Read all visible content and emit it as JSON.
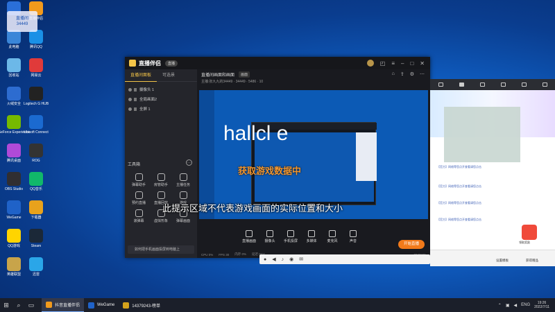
{
  "desktop": {
    "icons": [
      {
        "label": "",
        "color": "#2a6fd8"
      },
      {
        "label": "直播伴侣",
        "color": "#f29a1c"
      },
      {
        "label": "此电脑",
        "color": "#3a86d8"
      },
      {
        "label": "腾讯QQ",
        "color": "#1a90e6"
      },
      {
        "label": "回收站",
        "color": "#6cb8e8"
      },
      {
        "label": "网易云",
        "color": "#e03a3a"
      },
      {
        "label": "火绒安全",
        "color": "#2d6cd0"
      },
      {
        "label": "Logitech G HUB",
        "color": "#222222"
      },
      {
        "label": "GeForce Experience",
        "color": "#76b900"
      },
      {
        "label": "Ubisoft Connect",
        "color": "#1b6ad0"
      },
      {
        "label": "腾讯桌面",
        "color": "#b04ad8"
      },
      {
        "label": "ROG",
        "color": "#333333"
      },
      {
        "label": "OBS Studio",
        "color": "#302e31"
      },
      {
        "label": "QQ音乐",
        "color": "#11b86a"
      },
      {
        "label": "WeGame",
        "color": "#1f62c8"
      },
      {
        "label": "下载器",
        "color": "#e8a21c"
      },
      {
        "label": "QQ游戏",
        "color": "#ffd400"
      },
      {
        "label": "Steam",
        "color": "#1b2838"
      },
      {
        "label": "英雄联盟",
        "color": "#c8a44a"
      },
      {
        "label": "迅雷",
        "color": "#2aa6e8"
      }
    ],
    "overlay_badge": "直播间",
    "overlay_number": "34449"
  },
  "app": {
    "logo_text": "直播伴侣",
    "badge": "直播",
    "scene_tab": "直播间面板",
    "scene_tab2": "可选景",
    "source_items": [
      "摄像头 1",
      "全局画面2",
      "全屏 1"
    ],
    "header_title": "直播间画面和画面",
    "header_button": "画面",
    "header_info": "主播:张九九的34449 · 34449 · 5486 · 10",
    "tools_title": "工具箱",
    "tools": [
      {
        "label": "弹幕助手"
      },
      {
        "label": "房管助手"
      },
      {
        "label": "主播任务"
      },
      {
        "label": "预约直播"
      },
      {
        "label": "直播回放"
      },
      {
        "label": "游戏"
      },
      {
        "label": "滚弹幕"
      },
      {
        "label": "虚拟形象"
      },
      {
        "label": "弹幕画面"
      }
    ],
    "notice": "如何把手机画面投屏到电脑上",
    "bottom_items": [
      {
        "label": "直播画面"
      },
      {
        "label": "摄像头"
      },
      {
        "label": "手机投屏"
      },
      {
        "label": "多媒体"
      },
      {
        "label": "麦克风"
      },
      {
        "label": "声音"
      }
    ],
    "live_button": "开始直播",
    "status_items": [
      "CPU 0%",
      "FPS 30",
      "内存 0%",
      "延迟 0ms"
    ],
    "status_time": "00:00:01"
  },
  "captions": {
    "game_data": "获取游戏数据中",
    "notice": "此提示区域不代表游戏画面的实际位置和大小",
    "big_text": "hallcl e"
  },
  "browser": {
    "lines": [
      "【官方】网络等您点开查看请您点击",
      "【官方】网络等您点开查看请您点击",
      "【官方】网络等您点开查看请您点击",
      "【官方】网络等您点开查看请您点击"
    ],
    "footer_left": "设置模板",
    "footer_right": "获得赠品",
    "gift_label": "领取奖励"
  },
  "taskbar": {
    "tasks": [
      {
        "label": "抖音直播伴侣",
        "color": "#f29a1c"
      },
      {
        "label": "WeGame",
        "color": "#1f62c8"
      },
      {
        "label": "14379243-榜单",
        "color": "#d4a21c"
      }
    ],
    "lang": "ENG",
    "time": "19:26",
    "date": "2022/7/11"
  },
  "colors": {
    "accent": "#f3c448",
    "live": "#f27a1a",
    "caption_orange": "#f2962f"
  }
}
